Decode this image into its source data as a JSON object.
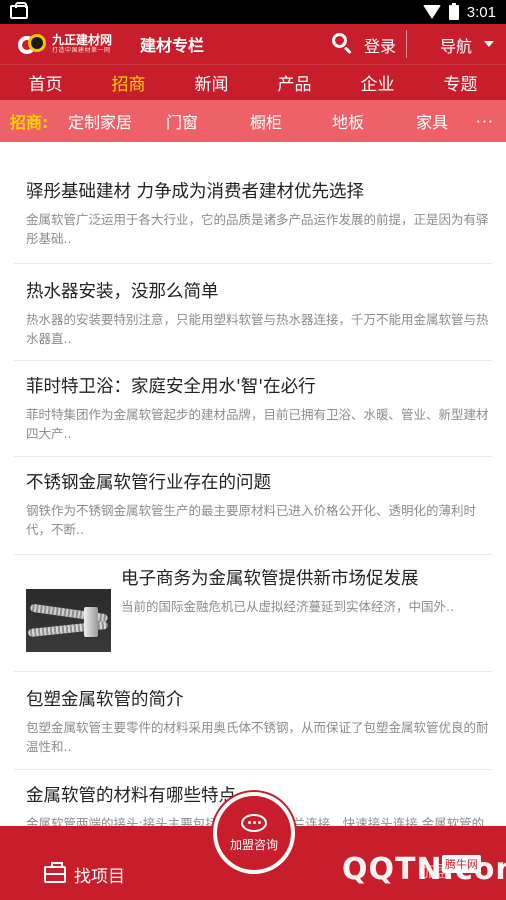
{
  "status": {
    "time": "3:01"
  },
  "appbar": {
    "logo_name": "九正建材网",
    "logo_slogan": "打造中国建材第一网",
    "title": "建材专栏",
    "login": "登录",
    "nav": "导航"
  },
  "categories": [
    "首页",
    "招商",
    "新闻",
    "产品",
    "企业",
    "专题"
  ],
  "subnav": {
    "label": "招商:",
    "items": [
      "定制家居",
      "门窗",
      "橱柜",
      "地板",
      "家具"
    ],
    "more": "···"
  },
  "articles": [
    {
      "title": "驿彤基础建材 力争成为消费者建材优先选择",
      "summary": "金属软管广泛运用于各大行业，它的品质是诸多产品运作发展的前提，正是因为有驿彤基础.."
    },
    {
      "title": "热水器安装，没那么简单",
      "summary": "热水器的安装要特别注意，只能用塑料软管与热水器连接，千万不能用金属软管与热水器直.."
    },
    {
      "title": "菲时特卫浴：家庭安全用水'智'在必行",
      "summary": "菲时特集团作为金属软管起步的建材品牌，目前已拥有卫浴、水暖、管业、新型建材四大产.."
    },
    {
      "title": "不锈钢金属软管行业存在的问题",
      "summary": "钢铁作为不锈钢金属软管生产的最主要原材料已进入价格公开化、透明化的薄利时代，不断.."
    },
    {
      "title": "电子商务为金属软管提供新市场促发展",
      "summary": "当前的国际金融危机已从虚拟经济蔓延到实体经济，中国外.."
    },
    {
      "title": "包塑金属软管的简介",
      "summary": "包塑金属软管主要零件的材料采用奥氏体不锈钢，从而保证了包塑金属软管优良的耐温性和.."
    },
    {
      "title": "金属软管的材料有哪些特点",
      "summary": "金属软管两端的接头:接头主要包括螺纹连接、法兰连接、快速接头连接.金属软管的三大.."
    }
  ],
  "bottombar": {
    "left": "找项目",
    "center": "加盟咨询",
    "right": "加盟"
  },
  "watermark": {
    "text": "QQTN.com",
    "tag": "腾牛网"
  }
}
